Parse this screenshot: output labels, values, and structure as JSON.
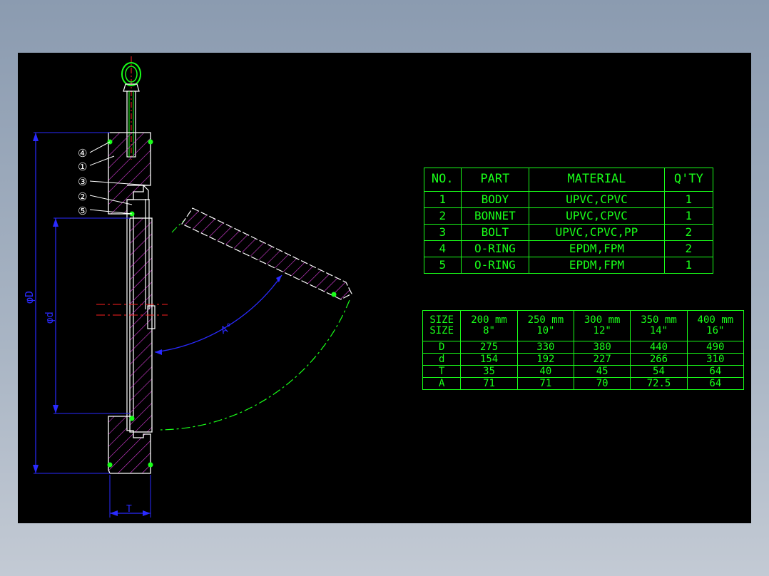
{
  "parts_table": {
    "headers": [
      "NO.",
      "PART",
      "MATERIAL",
      "Q'TY"
    ],
    "rows": [
      [
        "1",
        "BODY",
        "UPVC,CPVC",
        "1"
      ],
      [
        "2",
        "BONNET",
        "UPVC,CPVC",
        "1"
      ],
      [
        "3",
        "BOLT",
        "UPVC,CPVC,PP",
        "2"
      ],
      [
        "4",
        "O-RING",
        "EPDM,FPM",
        "2"
      ],
      [
        "5",
        "O-RING",
        "EPDM,FPM",
        "1"
      ]
    ]
  },
  "size_table": {
    "header_labels": [
      "SIZE",
      "SIZE"
    ],
    "columns": [
      {
        "mm": "200 mm",
        "inch": "8\""
      },
      {
        "mm": "250 mm",
        "inch": "10\""
      },
      {
        "mm": "300 mm",
        "inch": "12\""
      },
      {
        "mm": "350 mm",
        "inch": "14\""
      },
      {
        "mm": "400 mm",
        "inch": "16\""
      }
    ],
    "rows": [
      {
        "label": "D",
        "values": [
          "275",
          "330",
          "380",
          "440",
          "490"
        ]
      },
      {
        "label": "d",
        "values": [
          "154",
          "192",
          "227",
          "266",
          "310"
        ]
      },
      {
        "label": "T",
        "values": [
          "35",
          "40",
          "45",
          "54",
          "64"
        ]
      },
      {
        "label": "A",
        "values": [
          "71",
          "71",
          "70",
          "72.5",
          "64"
        ]
      }
    ]
  },
  "drawing": {
    "balloons": [
      "④",
      "①",
      "③",
      "②",
      "⑤"
    ],
    "dim_outer_diameter": "φD",
    "dim_inner_diameter": "φd",
    "dim_thickness": "T",
    "dim_angle": "A°"
  },
  "colors": {
    "background": "#000000",
    "table_lines": "#19ff19",
    "hatch": "#e040e0",
    "dimension": "#2a2aff",
    "center_line": "#ff2020",
    "outline": "#ffffff"
  }
}
